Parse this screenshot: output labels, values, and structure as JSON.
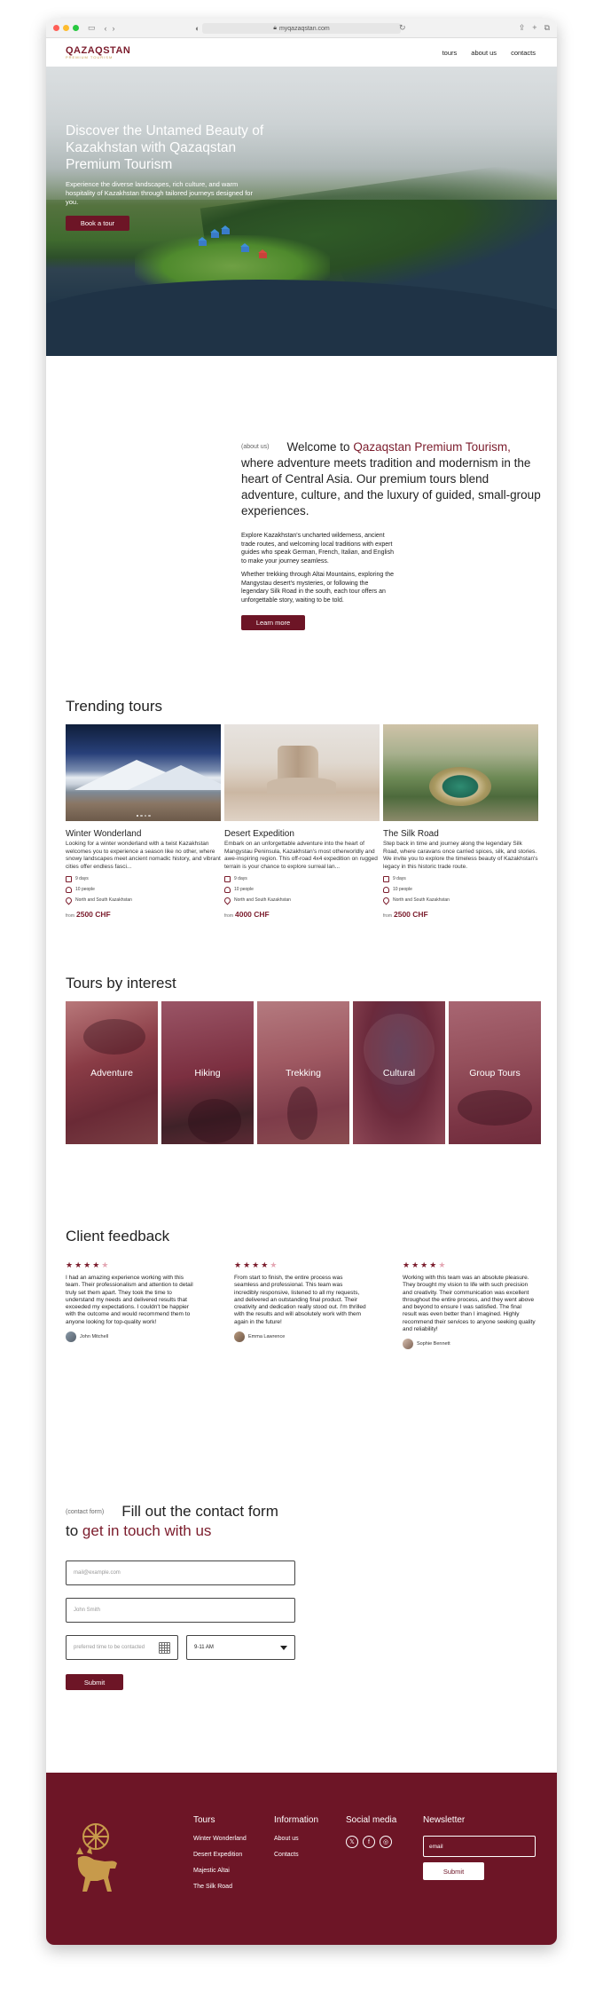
{
  "browser": {
    "address": "myqazaqstan.com"
  },
  "brand": {
    "name": "QAZAQSTAN",
    "tagline": "PREMIUM TOURISM"
  },
  "nav": {
    "items": [
      "tours",
      "about us",
      "contacts"
    ]
  },
  "hero": {
    "title": "Discover the Untamed Beauty of Kazakhstan with Qazaqstan Premium Tourism",
    "description": "Experience the diverse landscapes, rich culture, and warm hospitality of Kazakhstan through tailored journeys designed for you.",
    "cta": "Book a tour"
  },
  "about": {
    "tag": "(about us)",
    "lead_before": "Welcome to ",
    "lead_accent": "Qazaqstan Premium Tourism,",
    "lead_after": " where adventure meets tradition and modernism in the heart of Central Asia. Our premium tours blend adventure, culture, and the luxury of guided, small-group experiences.",
    "paragraph1": "Explore Kazakhstan's uncharted wilderness, ancient trade routes, and welcoming local traditions with expert guides who speak German, French, Italian, and English to make your journey seamless.",
    "paragraph2": "Whether trekking through Altai Mountains, exploring the Mangystau desert's mysteries, or following the legendary Silk Road in the south, each tour offers an unforgettable story, waiting to be told.",
    "cta": "Learn more"
  },
  "trending": {
    "title": "Trending tours",
    "tours": [
      {
        "name": "Winter Wonderland",
        "description": "Looking for a winter wonderland with a twist Kazakhstan welcomes you to experience a season like no other, where snowy landscapes meet ancient nomadic history, and vibrant cities offer endless fasci...",
        "duration": "9 days",
        "group": "10 people",
        "region": "North and South Kazakhstan",
        "price_prefix": "from",
        "price": "2500 CHF"
      },
      {
        "name": "Desert Expedition",
        "description": "Embark on an unforgettable adventure into the heart of Mangystau Peninsula, Kazakhstan's most otherworldly and awe-inspiring region. This off-road 4x4 expedition on rugged terrain is your chance to explore surreal lan...",
        "duration": "9 days",
        "group": "10 people",
        "region": "North and South Kazakhstan",
        "price_prefix": "from",
        "price": "4000 CHF"
      },
      {
        "name": "The Silk Road",
        "description": "Step back in time and journey along the legendary Silk Road, where caravans once carried spices, silk, and stories. We invite you to explore the timeless beauty of Kazakhstan's legacy in this historic trade route.",
        "duration": "9 days",
        "group": "10 people",
        "region": "North and South Kazakhstan",
        "price_prefix": "from",
        "price": "2500 CHF"
      }
    ]
  },
  "interest": {
    "title": "Tours by interest",
    "items": [
      "Adventure",
      "Hiking",
      "Trekking",
      "Cultural",
      "Group Tours"
    ]
  },
  "feedback": {
    "title": "Client feedback",
    "reviews": [
      {
        "rating": 4,
        "text": "I had an amazing experience working with this team. Their professionalism and attention to detail truly set them apart. They took the time to understand my needs and delivered results that exceeded my expectations. I couldn't be happier with the outcome and would recommend them to anyone looking for top-quality work!",
        "name": "John Mitchell"
      },
      {
        "rating": 4,
        "text": "From start to finish, the entire process was seamless and professional. This team was incredibly responsive, listened to all my requests, and delivered an outstanding final product. Their creativity and dedication really stood out. I'm thrilled with the results and will absolutely work with them again in the future!",
        "name": "Emma Lawrence"
      },
      {
        "rating": 4,
        "text": "Working with this team was an absolute pleasure. They brought my vision to life with such precision and creativity. Their communication was excellent throughout the entire process, and they went above and beyond to ensure I was satisfied. The final result was even better than I imagined. Highly recommend their services to anyone seeking quality and reliability!",
        "name": "Sophie Bennett"
      }
    ]
  },
  "contact": {
    "tag": "(contact form)",
    "title_line1": "Fill out the contact form",
    "title_to": "to ",
    "title_accent": "get in touch with us",
    "email_placeholder": "mail@example.com",
    "name_placeholder": "John Smith",
    "time_placeholder": "preferred time to be contacted",
    "time_select": "9-11 AM",
    "submit": "Submit"
  },
  "footer": {
    "tours_title": "Tours",
    "tours_links": [
      "Winter Wonderland",
      "Desert Expedition",
      "Majestic Altai",
      "The Silk Road"
    ],
    "info_title": "Information",
    "info_links": [
      "About us",
      "Contacts"
    ],
    "social_title": "Social media",
    "social_icons": [
      "x-icon",
      "facebook-icon",
      "instagram-icon"
    ],
    "newsletter_title": "Newsletter",
    "newsletter_placeholder": "email",
    "newsletter_button": "Submit"
  },
  "colors": {
    "brand": "#6d1526",
    "accent": "#7b1c2c",
    "gold": "#c79a4b"
  }
}
